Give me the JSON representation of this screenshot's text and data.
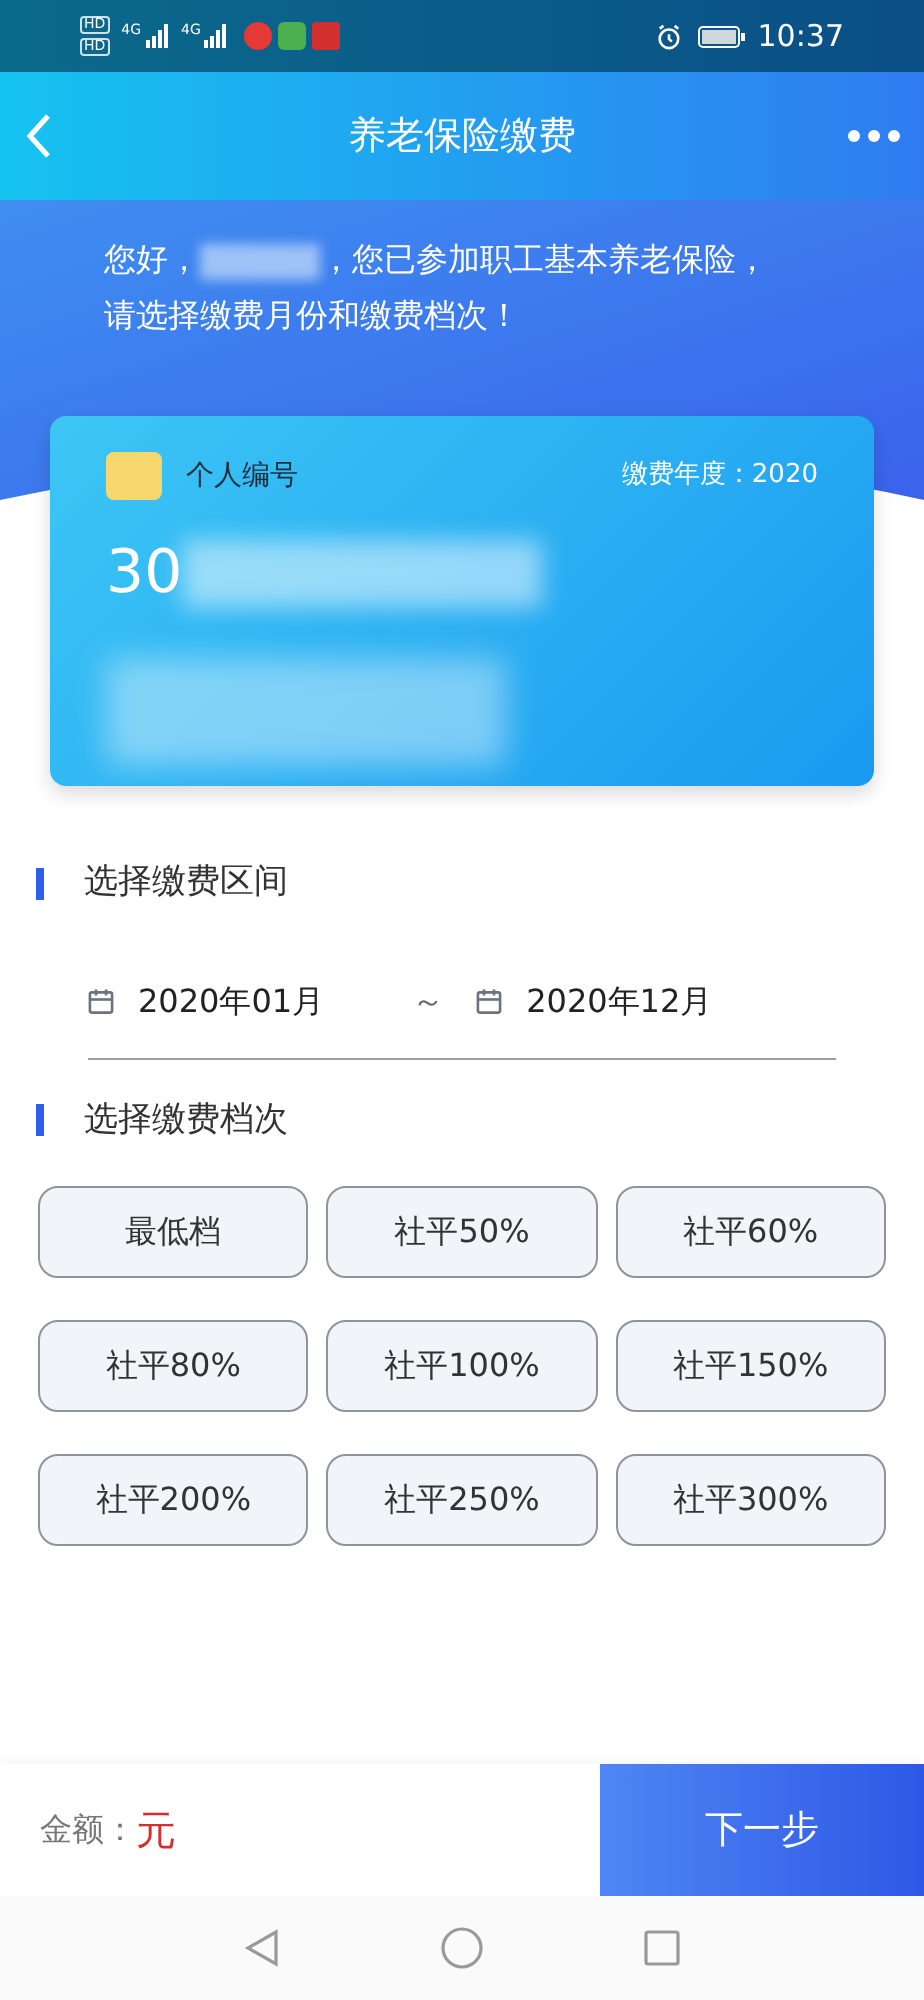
{
  "status_bar": {
    "hd_badges": [
      "HD",
      "HD"
    ],
    "networks": [
      "4G",
      "4G"
    ],
    "time": "10:37"
  },
  "header": {
    "title": "养老保险缴费"
  },
  "greeting": {
    "before": "您好，",
    "after": "，您已参加职工基本养老保险，请选择缴费月份和缴费档次！"
  },
  "card": {
    "label": "个人编号",
    "year": "缴费年度：2020",
    "number_visible": "30"
  },
  "period": {
    "title": "选择缴费区间",
    "start": "2020年01月",
    "separator": "～",
    "end": "2020年12月"
  },
  "tiers": {
    "title": "选择缴费档次",
    "options": [
      {
        "label": "最低档",
        "selected": false
      },
      {
        "label": "社平50%",
        "selected": false
      },
      {
        "label": "社平60%",
        "selected": false
      },
      {
        "label": "社平80%",
        "selected": false
      },
      {
        "label": "社平100%",
        "selected": false
      },
      {
        "label": "社平150%",
        "selected": false
      },
      {
        "label": "社平200%",
        "selected": false
      },
      {
        "label": "社平250%",
        "selected": false
      },
      {
        "label": "社平300%",
        "selected": false
      }
    ]
  },
  "footer": {
    "amount_label": "金额：",
    "amount_unit": "元",
    "next": "下一步"
  }
}
